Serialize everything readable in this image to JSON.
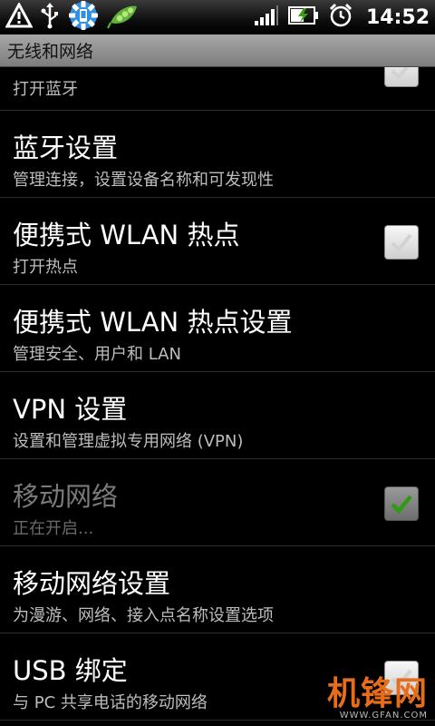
{
  "statusbar": {
    "time": "14:52",
    "icons": [
      "warning-icon",
      "usb-icon",
      "settings-icon",
      "pea-pod-icon",
      "signal-icon",
      "battery-charging-icon",
      "alarm-clock-icon"
    ]
  },
  "header": {
    "title": "无线和网络"
  },
  "list": {
    "bt_toggle_sub": "打开蓝牙",
    "items": [
      {
        "title": "蓝牙设置",
        "subtitle": "管理连接，设置设备名称和可发现性"
      },
      {
        "title": "便携式 WLAN 热点",
        "subtitle": "打开热点"
      },
      {
        "title": "便携式 WLAN 热点设置",
        "subtitle": "管理安全、用户和 LAN"
      },
      {
        "title": "VPN 设置",
        "subtitle": "设置和管理虚拟专用网络 (VPN)"
      },
      {
        "title": "移动网络",
        "subtitle": "正在开启..."
      },
      {
        "title": "移动网络设置",
        "subtitle": "为漫游、网络、接入点名称设置选项"
      },
      {
        "title": "USB 绑定",
        "subtitle": "与 PC 共享电话的移动网络"
      }
    ]
  },
  "watermark": {
    "big": "机锋网",
    "small": "WWW.GFAN.COM"
  },
  "colors": {
    "watermark": "#e86d1a",
    "check_green": "#2f9a13"
  }
}
